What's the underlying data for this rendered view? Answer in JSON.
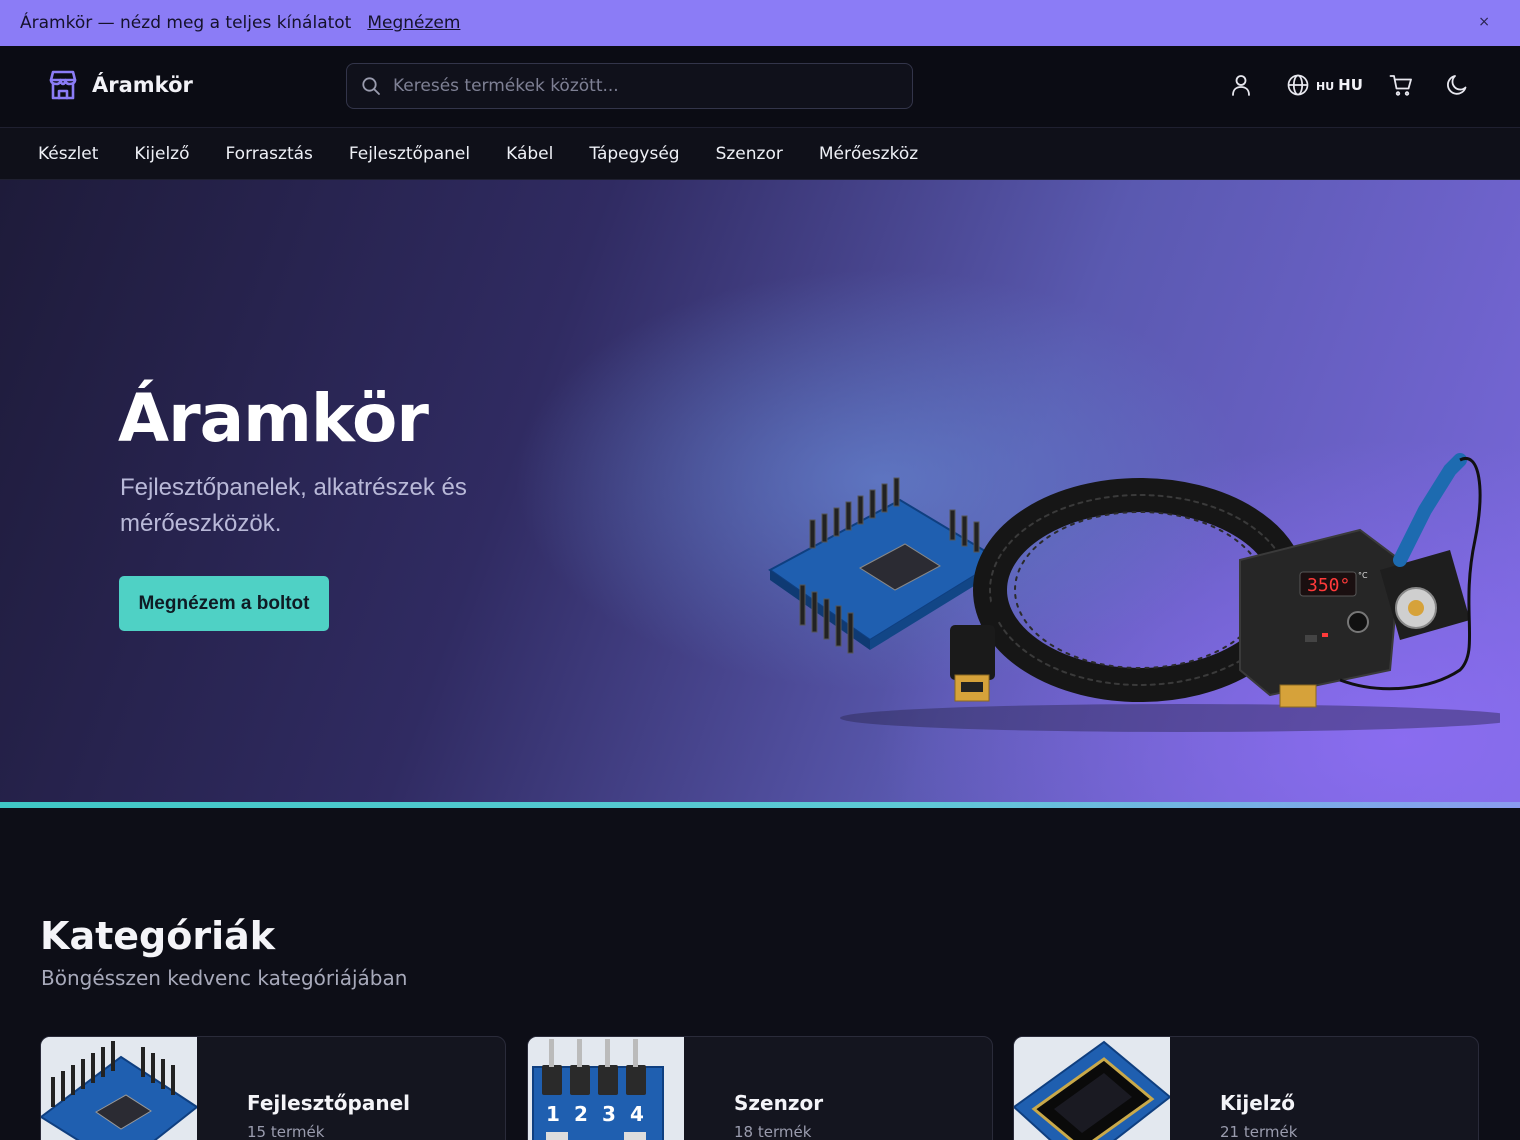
{
  "announcement": {
    "text": "Áramkör — nézd meg a teljes kínálatot",
    "link": "Megnézem",
    "close": "×"
  },
  "header": {
    "brand": "Áramkör",
    "search_placeholder": "Keresés termékek között...",
    "lang_small": "HU",
    "lang_big": "HU"
  },
  "nav": {
    "items": [
      "Készlet",
      "Kijelző",
      "Forrasztás",
      "Fejlesztőpanel",
      "Kábel",
      "Tápegység",
      "Szenzor",
      "Mérőeszköz"
    ]
  },
  "hero": {
    "title": "Áramkör",
    "subtitle": "Fejlesztőpanelek, alkatrészek és mérőeszközök.",
    "cta": "Megnézem a boltot",
    "station_display": "350°",
    "station_unit": "°C"
  },
  "categories": {
    "title": "Kategóriák",
    "subtitle": "Böngésszen kedvenc kategóriájában",
    "items": [
      {
        "name": "Fejlesztőpanel",
        "count": "15 termék",
        "icon": "dev-board-image"
      },
      {
        "name": "Szenzor",
        "count": "18 termék",
        "icon": "sensor-module-image"
      },
      {
        "name": "Kijelző",
        "count": "21 termék",
        "icon": "display-module-image"
      }
    ],
    "sensor_pins": [
      "1",
      "2",
      "3",
      "4"
    ]
  },
  "colors": {
    "announcement_bg": "#8b7cf6",
    "accent": "#4fd1c5",
    "brand_icon": "#8b7cf6",
    "background": "#0d0e17"
  }
}
